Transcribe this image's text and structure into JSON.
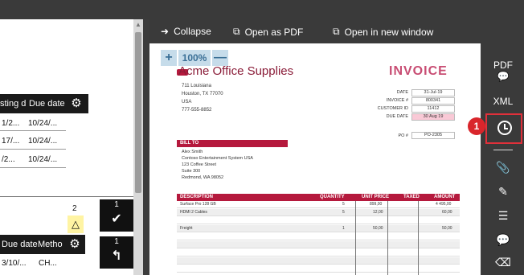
{
  "left_panel": {
    "table1": {
      "headers": [
        "sting d",
        "Due date"
      ],
      "rows": [
        [
          "1/2...",
          "10/24/..."
        ],
        [
          "17/...",
          "10/24/..."
        ],
        [
          "/2...",
          "10/24/..."
        ]
      ]
    },
    "pending_count": "2",
    "approve_count": "1",
    "return_count": "1",
    "warn_glyph": "△",
    "table2": {
      "headers": [
        "Due date",
        "Metho"
      ],
      "rows": [
        [
          "3/10/...",
          "CH..."
        ]
      ]
    }
  },
  "preview_toolbar": {
    "collapse": "Collapse",
    "open_pdf": "Open as PDF",
    "open_window": "Open in new window"
  },
  "zoom": {
    "minus": "—",
    "level": "100%",
    "plus": "+"
  },
  "invoice": {
    "company": "Acme Office Supplies",
    "title": "INVOICE",
    "address": "711 Louisiana\nHouston, TX 77070\nUSA\n777-555-8852",
    "meta": [
      {
        "k": "DATE",
        "v": "31-Jul-19"
      },
      {
        "k": "INVOICE #",
        "v": "800341"
      },
      {
        "k": "CUSTOMER ID",
        "v": "11412"
      },
      {
        "k": "DUE DATE",
        "v": "30 Aug 19"
      }
    ],
    "po_label": "PO #",
    "po_value": "PO-2305",
    "bill_to_label": "BILL TO",
    "bill_to": "Alex Smith\nContoso Entertainment System USA\n123 Coffee Street\nSuite 300\nRedmond, WA 98052",
    "columns": [
      "DESCRIPTION",
      "QUANTITY",
      "UNIT PRICE",
      "TAXED",
      "AMOUNT"
    ],
    "items": [
      {
        "desc": "Surface Pro 128 GB",
        "qty": "5",
        "price": "899,00",
        "amount": "4 495,00"
      },
      {
        "desc": "HDMI 2 Cables",
        "qty": "5",
        "price": "12,00",
        "amount": "60,00"
      },
      {
        "desc": "",
        "qty": "",
        "price": "",
        "amount": ""
      },
      {
        "desc": "Freight",
        "qty": "1",
        "price": "50,00",
        "amount": "50,00"
      }
    ]
  },
  "sidebar": {
    "pdf": "PDF",
    "xml": "XML",
    "badge": "1"
  }
}
